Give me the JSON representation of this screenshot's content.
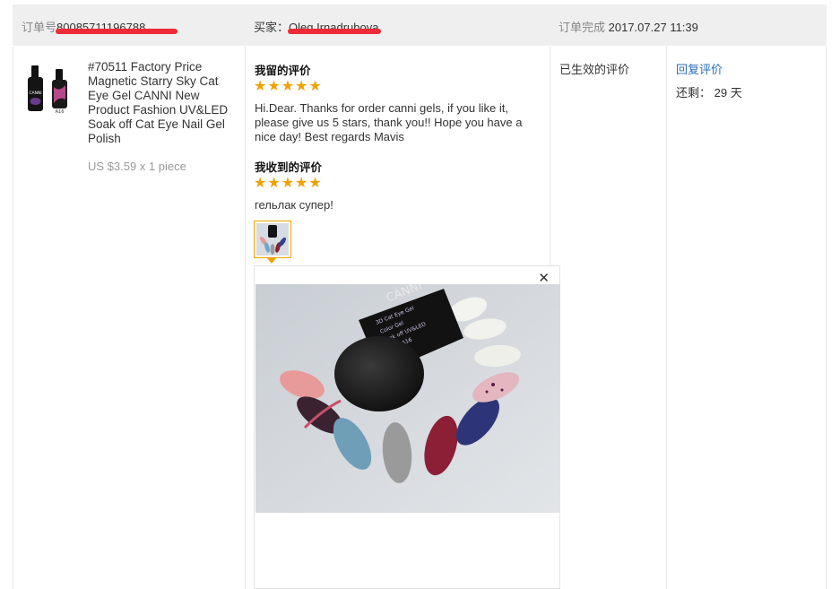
{
  "order": {
    "order_label": "订单号",
    "order_number": "80085711196788",
    "buyer_label": "买家：",
    "buyer_name": "Oleg Irnadrubova",
    "complete_label": "订单完成",
    "complete_time": "2017.07.27 11:39"
  },
  "product": {
    "title": "#70511 Factory Price Magnetic Starry Sky Cat Eye Gel CANNI New Product Fashion UV&LED Soak off Cat Eye Nail Gel Polish",
    "price": "US $3.59 x 1 piece",
    "thumb_brand": "CANNI",
    "thumb_code": "A16"
  },
  "my_review": {
    "title": "我留的评价",
    "stars": 5,
    "text": "Hi.Dear. Thanks for order canni gels, if you like it, please give us 5 stars, thank you!! Hope you have a nice day! Best regards Mavis"
  },
  "received_review": {
    "title": "我收到的评价",
    "stars": 5,
    "text": "гельлак супер!"
  },
  "photo": {
    "brand": "CANNI",
    "bottle_lines": [
      "3D Cat Eye Gel",
      "Color Gel",
      "Soak off UV&LED",
      "Color: A16"
    ]
  },
  "status": {
    "text": "已生效的评价"
  },
  "actions": {
    "reply_label": "回复评价",
    "remaining_label": "还剩：",
    "remaining_value": "29 天"
  },
  "icons": {
    "star": "star-icon",
    "close": "close-icon"
  },
  "colors": {
    "star": "#f0a100",
    "link": "#2a6fb5",
    "redaction": "#ee2a36",
    "header_bg": "#efefef"
  }
}
